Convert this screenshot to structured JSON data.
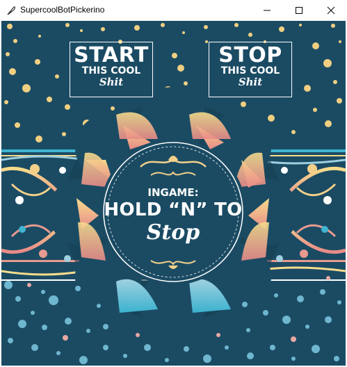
{
  "window": {
    "title": "SupercoolBotPickerino",
    "app_icon": "feather-icon",
    "controls": [
      "minimize-icon",
      "maximize-icon",
      "close-icon"
    ]
  },
  "start_button": {
    "line1": "START",
    "line2": "THIS COOL",
    "line3": "Shit"
  },
  "stop_button": {
    "line1": "STOP",
    "line2": "THIS COOL",
    "line3": "Shit"
  },
  "instructions": {
    "line1": "INGAME:",
    "line2": "HOLD “N” TO",
    "line3": "Stop"
  },
  "colors": {
    "background": "#1b4b63",
    "dot_gold": "#f0cf82",
    "dot_blue": "#6fb6cf",
    "ornament_pink": "#e89a8f",
    "ornament_gold": "#f3d08a",
    "ornament_cyan": "#3fb4d0"
  }
}
